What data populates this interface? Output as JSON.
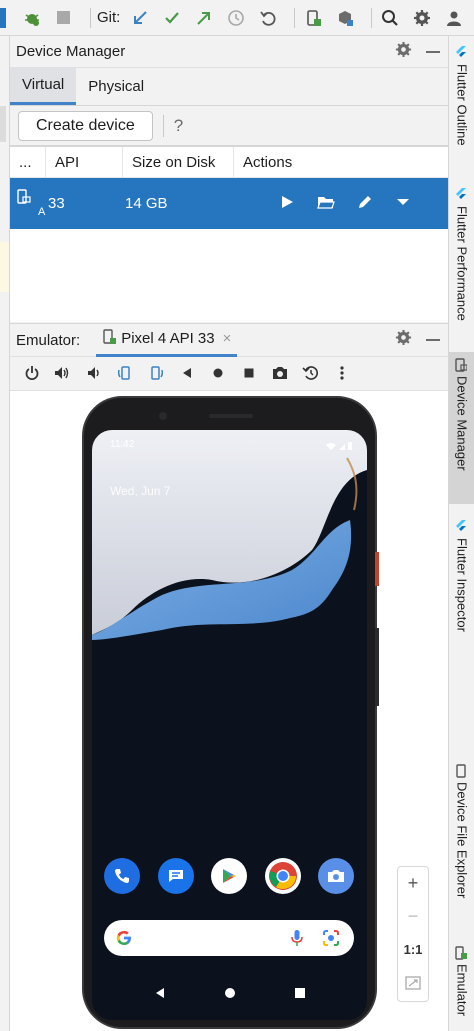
{
  "toolbar": {
    "git_label": "Git:",
    "icons": [
      "bug-icon",
      "stop-icon",
      "git-update-icon",
      "git-commit-icon",
      "git-push-icon",
      "history-icon",
      "rollback-icon",
      "device-mirror-icon",
      "sdk-manager-icon",
      "search-icon",
      "settings-icon",
      "profile-icon"
    ]
  },
  "device_manager": {
    "title": "Device Manager",
    "tabs": [
      "Virtual",
      "Physical"
    ],
    "active_tab": "Virtual",
    "create_button": "Create device",
    "help": "?",
    "columns": [
      "...",
      "API",
      "Size on Disk",
      "Actions"
    ],
    "rows": [
      {
        "name_abbrev": "A",
        "api": "33",
        "size": "14 GB"
      }
    ]
  },
  "emulator": {
    "label": "Emulator:",
    "tab_label": "Pixel 4 API 33",
    "tools": [
      "power-icon",
      "volume-up-icon",
      "volume-down-icon",
      "rotate-left-icon",
      "rotate-right-icon",
      "back-icon",
      "home-icon",
      "overview-icon",
      "screenshot-icon",
      "snapshot-icon",
      "more-icon"
    ]
  },
  "phone": {
    "time": "11:42",
    "date": "Wed, Jun 7",
    "dock_apps": [
      "phone-app-icon",
      "messages-app-icon",
      "play-store-icon",
      "chrome-icon",
      "camera-app-icon"
    ]
  },
  "zoom": {
    "plus": "+",
    "minus": "−",
    "one_to_one": "1:1"
  },
  "right_strip": {
    "tabs": [
      "Flutter Outline",
      "Flutter Performance",
      "Device Manager",
      "Flutter Inspector",
      "Device File Explorer",
      "Emulator"
    ],
    "active": "Device Manager"
  },
  "colors": {
    "accent": "#2675bf",
    "tab_underline": "#4083c9",
    "panel_bg": "#f2f2f2"
  }
}
